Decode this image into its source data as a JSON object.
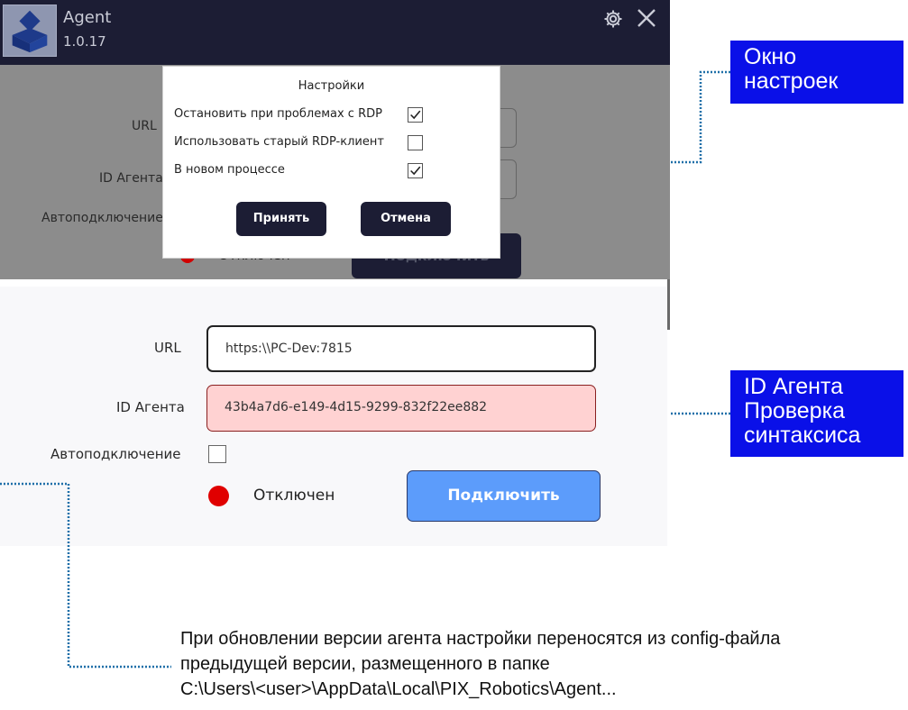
{
  "app": {
    "name": "Agent",
    "version": "1.0.17",
    "icons": {
      "logo": "agent-logo",
      "settings": "gear-icon",
      "close": "close-icon"
    }
  },
  "background_form": {
    "url_label": "URL",
    "agent_id_label": "ID Агента",
    "autoconnect_label": "Автоподключение",
    "status_text": "Отключен",
    "connect_button": "Подключить"
  },
  "settings_dialog": {
    "title": "Настройки",
    "options": [
      {
        "label": "Остановить при проблемах с RDP",
        "checked": true
      },
      {
        "label": "Использовать старый RDP-клиент",
        "checked": false
      },
      {
        "label": "В новом процессе",
        "checked": true
      }
    ],
    "accept_button": "Принять",
    "cancel_button": "Отмена"
  },
  "main_form": {
    "url_label": "URL",
    "url_value": "https:\\\\PC-Dev:7815",
    "agent_id_label": "ID Агента",
    "agent_id_value": "43b4a7d6-e149-4d15-9299-832f22ee882",
    "autoconnect_label": "Автоподключение",
    "autoconnect_checked": false,
    "status_text": "Отключен",
    "connect_button": "Подключить"
  },
  "annotations": {
    "callout_settings": [
      "Окно",
      "настроек"
    ],
    "callout_agent_id": [
      "ID Агента",
      "Проверка",
      "синтаксиса"
    ],
    "note_lines": [
      "При обновлении версии агента настройки переносятся из config-файла",
      "предыдущей версии, размещенного в папке",
      "C:\\Users\\<user>\\AppData\\Local\\PIX_Robotics\\Agent..."
    ]
  },
  "colors": {
    "titlebar": "#1c1d34",
    "callout": "#0a10e8",
    "error_field": "#ffd2d2",
    "connect_button": "#5c9cfb",
    "status_dot": "#e00000"
  }
}
